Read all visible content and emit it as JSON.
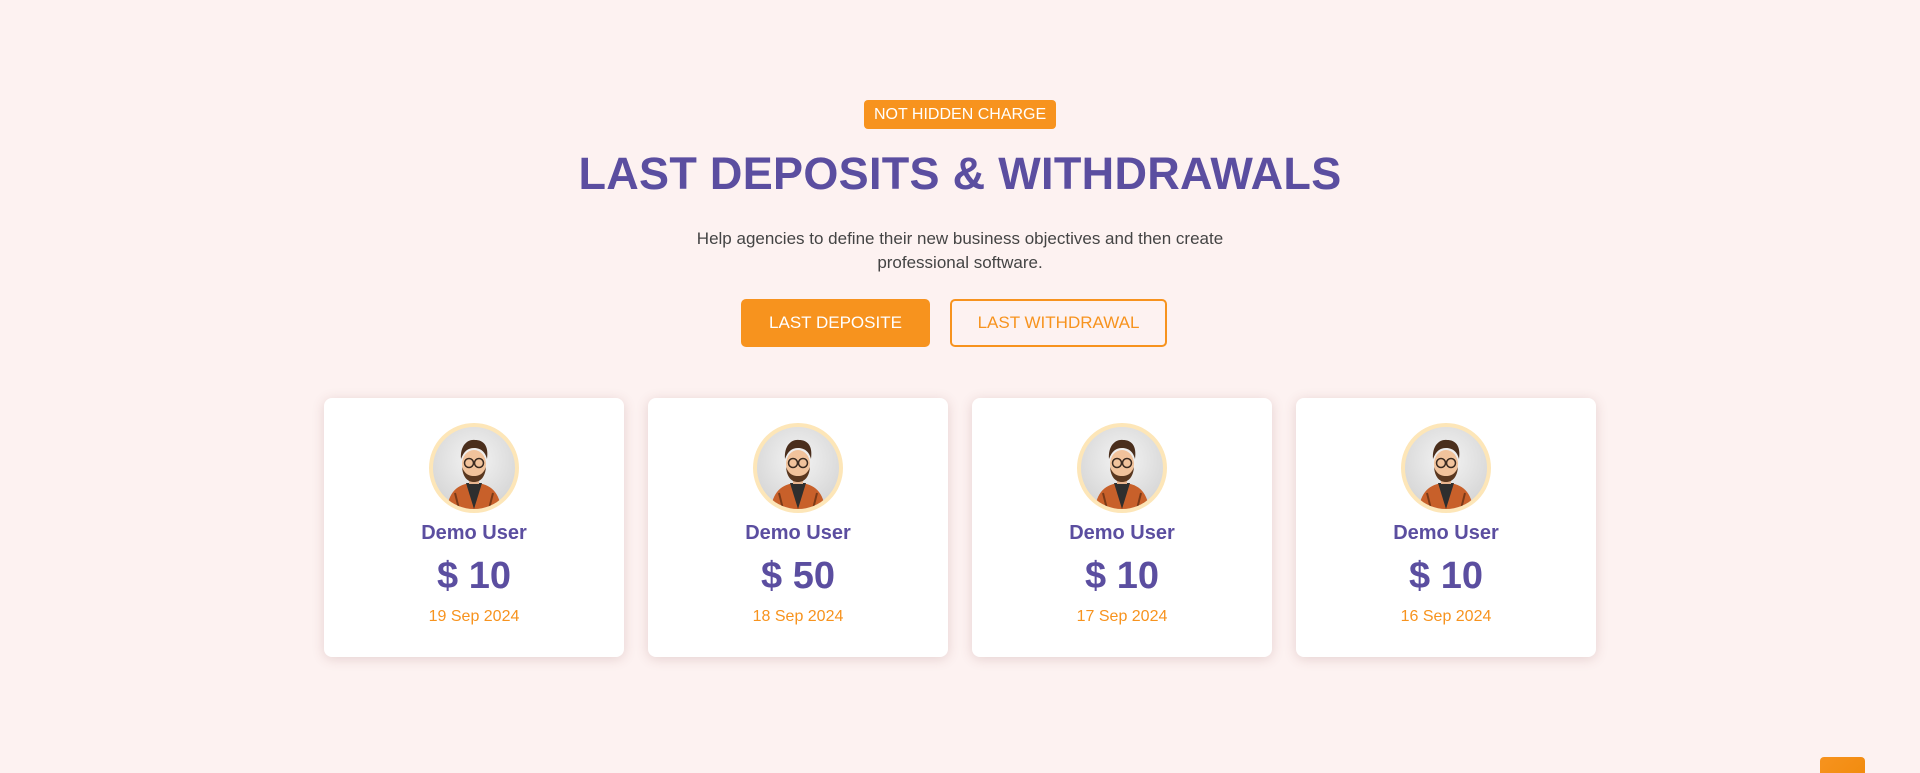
{
  "section": {
    "badge": "NOT HIDDEN CHARGE",
    "title": "LAST DEPOSITS & WITHDRAWALS",
    "subtitle": "Help agencies to define their new business objectives and then create professional software."
  },
  "tabs": {
    "deposit_label": "LAST DEPOSITE",
    "withdrawal_label": "LAST WITHDRAWAL"
  },
  "cards": [
    {
      "name": "Demo User",
      "amount": "$ 10",
      "date": "19 Sep 2024"
    },
    {
      "name": "Demo User",
      "amount": "$ 50",
      "date": "18 Sep 2024"
    },
    {
      "name": "Demo User",
      "amount": "$ 10",
      "date": "17 Sep 2024"
    },
    {
      "name": "Demo User",
      "amount": "$ 10",
      "date": "16 Sep 2024"
    }
  ],
  "colors": {
    "accent": "#f7931e",
    "heading": "#5b4ea0",
    "background": "#fdf2f1"
  },
  "icons": {
    "avatar": "user-avatar-icon",
    "scroll_top": "scroll-to-top-icon"
  }
}
